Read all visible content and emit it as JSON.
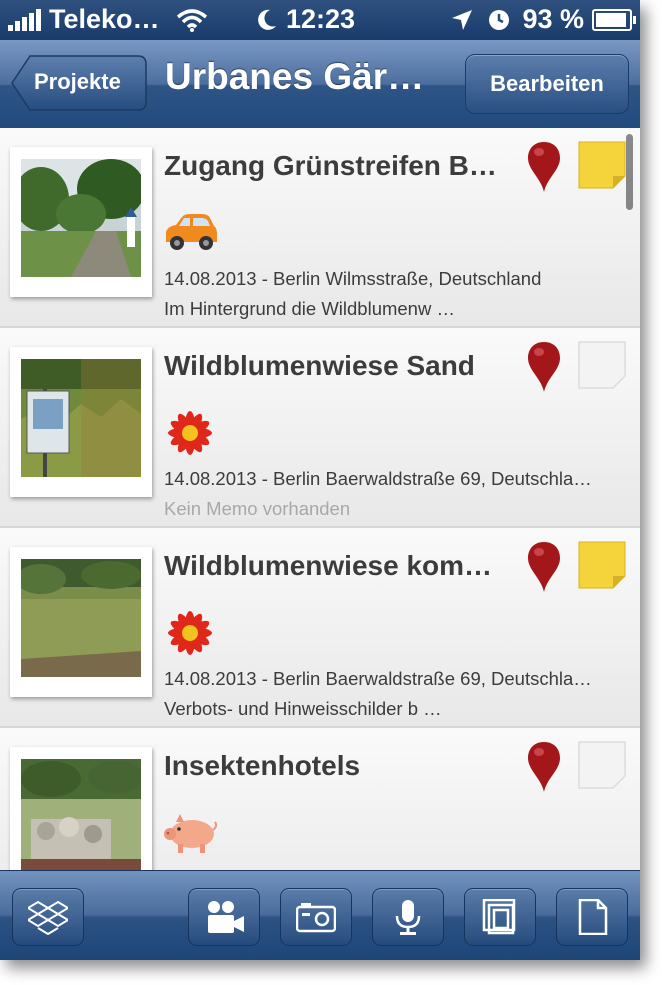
{
  "status_bar": {
    "carrier": "Teleko…",
    "time": "12:23",
    "battery": "93 %",
    "battery_level": 0.93
  },
  "nav": {
    "back_label": "Projekte",
    "title": "Urbanes Gär…",
    "edit_label": "Bearbeiten"
  },
  "entries": [
    {
      "title": "Zugang Grünstreifen B…",
      "meta": "14.08.2013 - Berlin Wilmsstraße, Deutschland",
      "memo": "Im Hintergrund die Wildblumenw …",
      "category_icon": "car-icon",
      "has_note": true
    },
    {
      "title": "Wildblumenwiese Sand",
      "meta": "14.08.2013 - Berlin Baerwaldstraße 69, Deutschla…",
      "memo": "Kein Memo vorhanden",
      "category_icon": "flower-icon",
      "has_note": false
    },
    {
      "title": "Wildblumenwiese kom…",
      "meta": "14.08.2013 - Berlin Baerwaldstraße 69, Deutschla…",
      "memo": "Verbots- und Hinweisschilder b …",
      "category_icon": "flower-icon",
      "has_note": true
    },
    {
      "title": "Insektenhotels",
      "meta": "",
      "memo": "",
      "category_icon": "pig-icon",
      "has_note": false
    }
  ],
  "toolbar": {
    "icons": [
      "dropbox-icon",
      "video-camera-icon",
      "camera-icon",
      "microphone-icon",
      "gallery-icon",
      "document-icon"
    ]
  },
  "colors": {
    "nav_blue": "#224a7c",
    "pin_red": "#a3171b",
    "note_yellow": "#f5d33a",
    "car_orange": "#f08a1e",
    "flower_red": "#e0281a",
    "pig_pink": "#f3a88a"
  }
}
